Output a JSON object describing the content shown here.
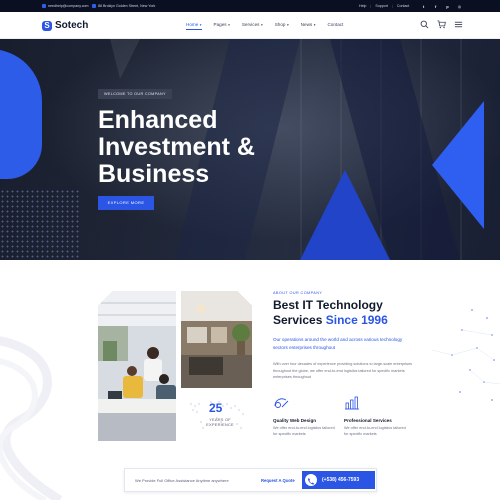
{
  "topbar": {
    "email": "needhelp@company.com",
    "address": "88 Broklyn Golden Street, New York",
    "links": [
      "Help",
      "Support",
      "Contact"
    ],
    "social_icons": [
      "twitter-icon",
      "facebook-icon",
      "pinterest-icon",
      "instagram-icon"
    ]
  },
  "header": {
    "logo_mark": "S",
    "logo_text": "Sotech",
    "nav": [
      "Home",
      "Pages",
      "Services",
      "Shop",
      "News",
      "Contact"
    ],
    "nav_dropdown": [
      true,
      true,
      true,
      true,
      true,
      false
    ],
    "active_nav": "Home",
    "icons": [
      "search-icon",
      "cart-icon",
      "menu-icon"
    ]
  },
  "hero": {
    "eyebrow": "WELCOME TO OUR COMPANY",
    "title_lines": [
      "Enhanced",
      "Investment &",
      "Business"
    ],
    "cta": "EXPLORE MORE"
  },
  "about": {
    "tag": "ABOUT OUR COMPANY",
    "title_part1": "Best IT Technology Services",
    "title_highlight": "Since 1996",
    "lead": "Our operations around the world and across various technology sectors enterprises throughout",
    "body": "With over four decades of experience providing solutions to large-scale enterprises throughout the globe, we offer end-to-end logistics tailored for specific markets enterprises throughout",
    "stat_number": "25",
    "stat_label": "YEARS OF EXPERIENCE",
    "features": [
      {
        "icon": "web-design-icon",
        "title": "Quality Web Design",
        "desc": "We offer end-to-end logistics tailored for specific markets"
      },
      {
        "icon": "services-chart-icon",
        "title": "Professional Services",
        "desc": "We offer end-to-end logistics tailored for specific markets"
      }
    ]
  },
  "contact_bar": {
    "text": "We Provide Full Office Assistance Anytime anywhere",
    "link": "Request A Quote",
    "phone": "(+538) 456-7593"
  },
  "colors": {
    "accent": "#2a55e5",
    "dark": "#0a1022",
    "heading": "#111a2e"
  }
}
